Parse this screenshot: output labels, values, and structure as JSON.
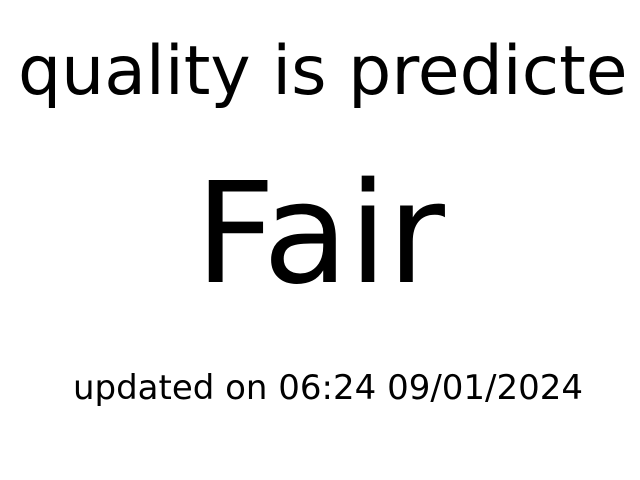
{
  "display": {
    "headline": "quality is predicte",
    "rating": "Fair",
    "updated_text": "updated on 06:24 09/01/2024"
  },
  "colors": {
    "background": "#ffffff",
    "text": "#000000"
  }
}
